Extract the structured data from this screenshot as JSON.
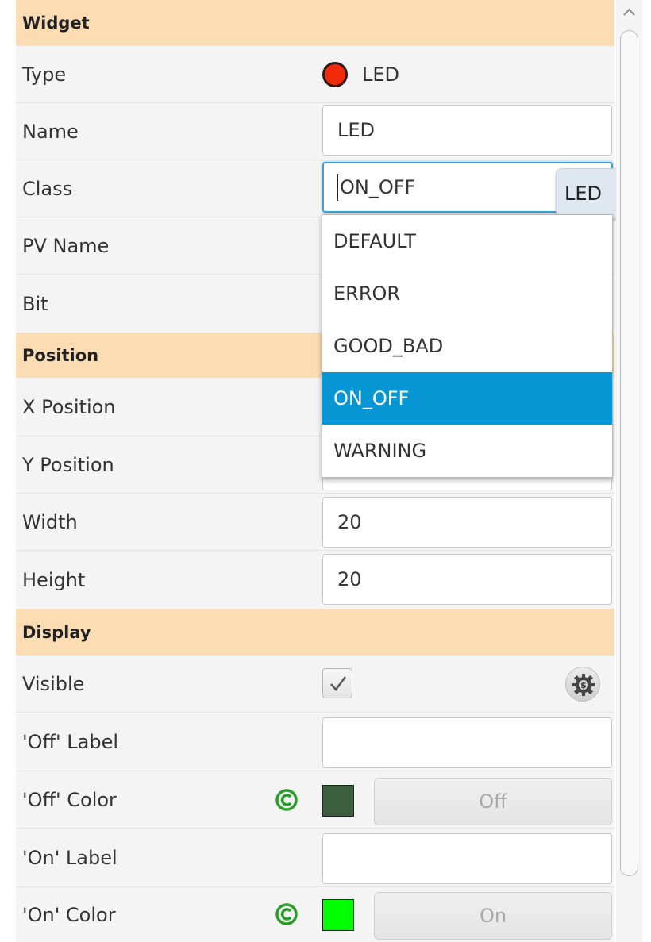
{
  "sections": {
    "widget": "Widget",
    "position": "Position",
    "display": "Display"
  },
  "rows": {
    "type": {
      "label": "Type",
      "value": "LED",
      "icon": "led-red-icon"
    },
    "name": {
      "label": "Name",
      "value": "LED"
    },
    "class": {
      "label": "Class",
      "value": "ON_OFF",
      "tooltip": "LED"
    },
    "pv_name": {
      "label": "PV Name"
    },
    "bit": {
      "label": "Bit"
    },
    "x_position": {
      "label": "X Position"
    },
    "y_position": {
      "label": "Y Position"
    },
    "width": {
      "label": "Width",
      "value": "20"
    },
    "height": {
      "label": "Height",
      "value": "20"
    },
    "visible": {
      "label": "Visible",
      "checked": true
    },
    "off_label": {
      "label": "'Off' Label",
      "value": ""
    },
    "off_color": {
      "label": "'Off' Color",
      "swatch": "#3b5e3c",
      "button": "Off"
    },
    "on_label": {
      "label": "'On' Label",
      "value": ""
    },
    "on_color": {
      "label": "'On' Color",
      "swatch": "#00ff00",
      "button": "On"
    }
  },
  "class_dropdown": {
    "options": [
      "DEFAULT",
      "ERROR",
      "GOOD_BAD",
      "ON_OFF",
      "WARNING"
    ],
    "selected": "ON_OFF"
  },
  "colors": {
    "section_bg": "#fbdcb3",
    "selected_bg": "#0796d4",
    "focus_border": "#3aa0d8",
    "led_red": "#f02a0a",
    "c_icon_green": "#2a9d2a"
  }
}
